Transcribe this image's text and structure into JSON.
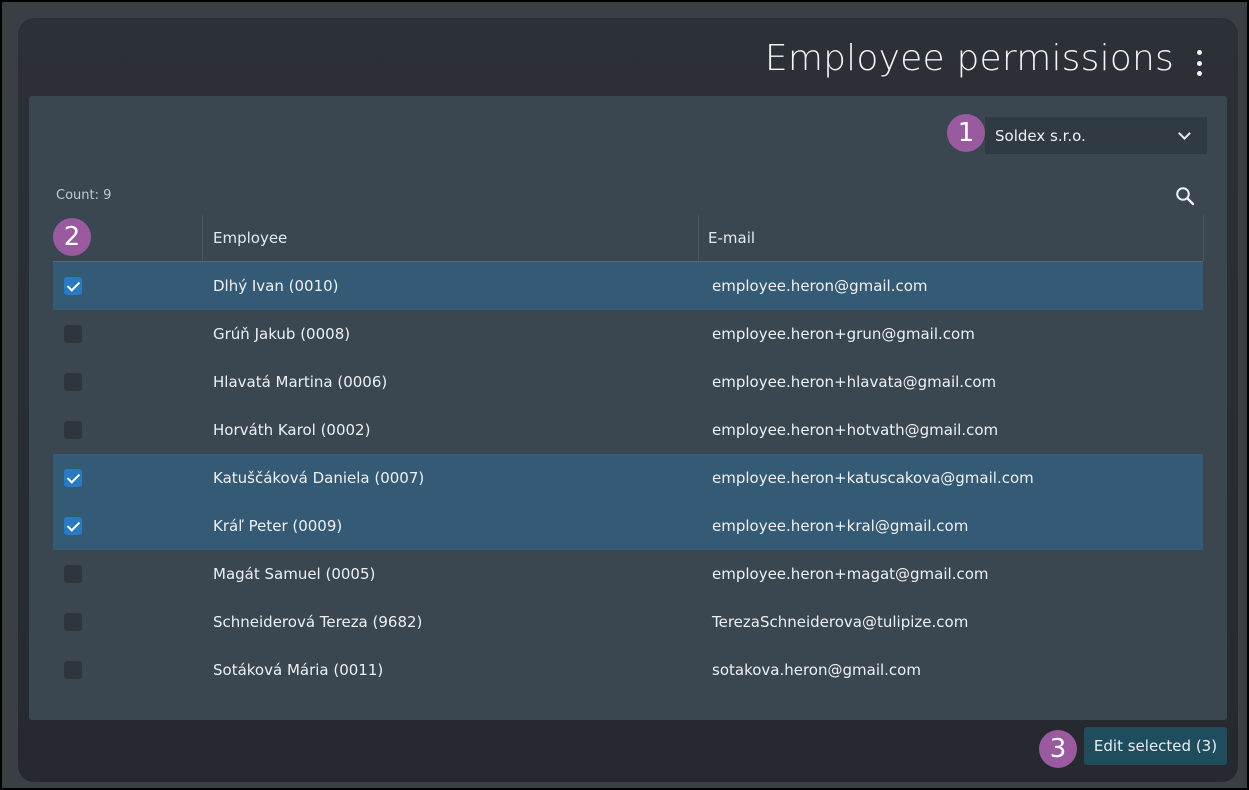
{
  "page": {
    "title": "Employee permissions"
  },
  "company": {
    "selected": "Soldex s.r.o."
  },
  "table": {
    "count_label": "Count: 9",
    "columns": [
      "Employee",
      "E-mail"
    ],
    "rows": [
      {
        "employee": "Dlhý Ivan (0010)",
        "email": "employee.heron@gmail.com",
        "checked": true
      },
      {
        "employee": "Grúň Jakub (0008)",
        "email": "employee.heron+grun@gmail.com",
        "checked": false
      },
      {
        "employee": "Hlavatá Martina (0006)",
        "email": "employee.heron+hlavata@gmail.com",
        "checked": false
      },
      {
        "employee": "Horváth Karol (0002)",
        "email": "employee.heron+hotvath@gmail.com",
        "checked": false
      },
      {
        "employee": "Katuščáková Daniela (0007)",
        "email": "employee.heron+katuscakova@gmail.com",
        "checked": true
      },
      {
        "employee": "Kráľ Peter (0009)",
        "email": "employee.heron+kral@gmail.com",
        "checked": true
      },
      {
        "employee": "Magát Samuel (0005)",
        "email": "employee.heron+magat@gmail.com",
        "checked": false
      },
      {
        "employee": "Schneiderová Tereza (9682)",
        "email": "TerezaSchneiderova@tulipize.com",
        "checked": false
      },
      {
        "employee": "Sotáková Mária (0011)",
        "email": "sotakova.heron@gmail.com",
        "checked": false
      }
    ]
  },
  "actions": {
    "edit_selected": "Edit selected (3)"
  },
  "callouts": [
    "1",
    "2",
    "3"
  ],
  "icons": {
    "menu": "more-vertical-icon",
    "dropdown": "chevron-down-icon",
    "search": "search-icon"
  },
  "colors": {
    "selected_row": "#355a75",
    "checkbox_checked": "#2a7ac2",
    "callout": "#9a5aa0",
    "button": "#1f4d5e"
  }
}
